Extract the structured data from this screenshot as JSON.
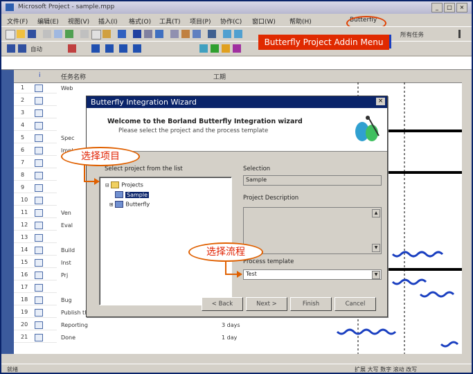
{
  "window": {
    "title": "Microsoft Project - sample.mpp"
  },
  "menu": {
    "items": [
      "文件(F)",
      "编辑(E)",
      "视图(V)",
      "插入(I)",
      "格式(O)",
      "工具(T)",
      "项目(P)",
      "协作(C)",
      "窗口(W)",
      "帮助(H)",
      "Butterfly"
    ],
    "highlight_label": "Butterfly Project Addin Menu"
  },
  "toolbar": {
    "group_label": "所有任务",
    "zoom_text": "自动"
  },
  "grid": {
    "col_info": "i",
    "col_task": "任务名称",
    "col_duration": "工期",
    "rows": [
      {
        "n": "1",
        "task": "Web"
      },
      {
        "n": "2",
        "task": ""
      },
      {
        "n": "3",
        "task": ""
      },
      {
        "n": "4",
        "task": ""
      },
      {
        "n": "5",
        "task": "Spec"
      },
      {
        "n": "6",
        "task": "Impl"
      },
      {
        "n": "7",
        "task": ""
      },
      {
        "n": "8",
        "task": ""
      },
      {
        "n": "9",
        "task": ""
      },
      {
        "n": "10",
        "task": ""
      },
      {
        "n": "11",
        "task": "Ven"
      },
      {
        "n": "12",
        "task": "Eval"
      },
      {
        "n": "13",
        "task": ""
      },
      {
        "n": "14",
        "task": "Build"
      },
      {
        "n": "15",
        "task": "Inst"
      },
      {
        "n": "16",
        "task": "Prj"
      },
      {
        "n": "17",
        "task": ""
      },
      {
        "n": "18",
        "task": "Bug"
      },
      {
        "n": "19",
        "task": "Publish the project to the Butterfly"
      },
      {
        "n": "20",
        "task": "Reporting"
      },
      {
        "n": "21",
        "task": "Done"
      }
    ],
    "durations": [
      "3 days",
      "3 days",
      "1 day"
    ]
  },
  "status": {
    "left": "就绪",
    "right": "扩展 大写 数字 滚动 改写"
  },
  "dialog": {
    "title": "Butterfly Integration Wizard",
    "heading": "Welcome to the Borland Butterfly Integration wizard",
    "subheading": "Please select the project and the process template",
    "tree_label": "Select project from the list",
    "tree_items": [
      "Projects",
      "Sample",
      "Butterfly"
    ],
    "selection_label": "Selection",
    "selection_value": "Sample",
    "description_label": "Project Description",
    "process_label": "Process template",
    "process_value": "Test",
    "buttons": {
      "back": "< Back",
      "next": "Next >",
      "finish": "Finish",
      "cancel": "Cancel"
    },
    "close_glyph": "×"
  },
  "callouts": {
    "select_project": "选择项目",
    "select_process": "选择流程"
  }
}
